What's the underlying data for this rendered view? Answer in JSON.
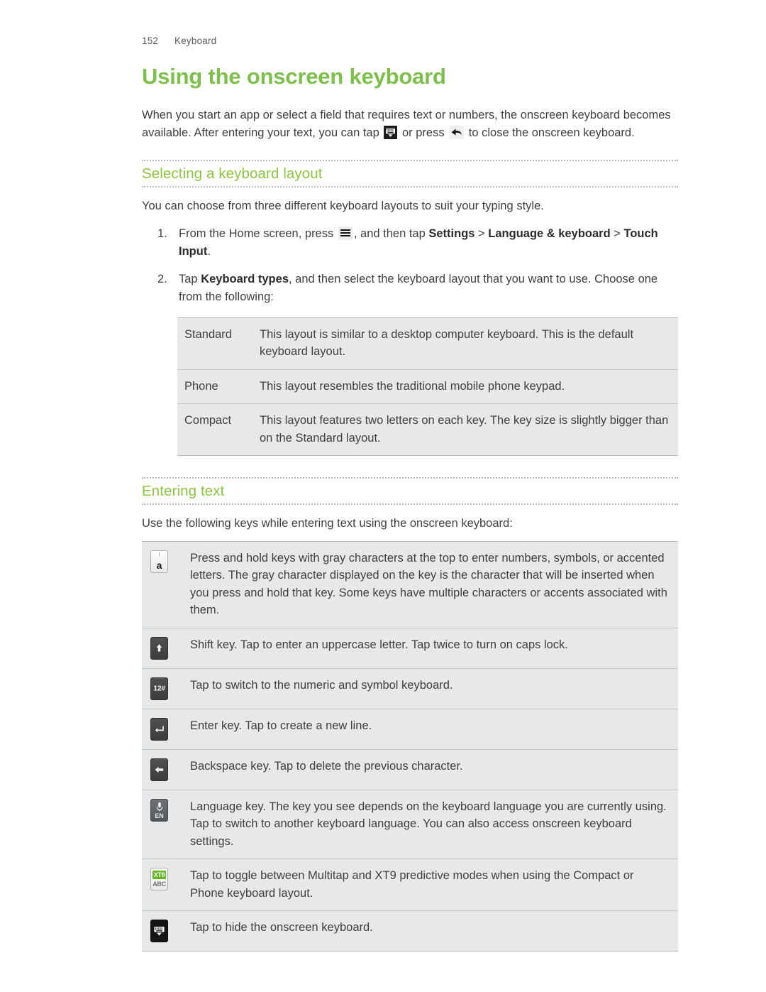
{
  "header": {
    "page_number": "152",
    "chapter": "Keyboard"
  },
  "title": "Using the onscreen keyboard",
  "intro": {
    "part1": "When you start an app or select a field that requires text or numbers, the onscreen keyboard becomes available. After entering your text, you can tap",
    "icon1": "hide-keyboard-icon",
    "part2": "or press",
    "icon2": "back-arrow-icon",
    "part3": "to close the onscreen keyboard."
  },
  "section1": {
    "heading": "Selecting a keyboard layout",
    "intro": "You can choose from three different keyboard layouts to suit your typing style.",
    "steps": [
      {
        "pre": "From the Home screen, press",
        "icon": "menu-icon",
        "mid": ", and then tap",
        "bold1": "Settings",
        "sep1": ">",
        "bold2": "Language & keyboard",
        "sep2": ">",
        "bold3": "Touch Input",
        "post": "."
      },
      {
        "pre": "Tap",
        "bold1": "Keyboard types",
        "post": ", and then select the keyboard layout that you want to use. Choose one from the following:"
      }
    ],
    "table": {
      "rows": [
        {
          "term": "Standard",
          "desc": "This layout is similar to a desktop computer keyboard. This is the default keyboard layout."
        },
        {
          "term": "Phone",
          "desc": "This layout resembles the traditional mobile phone keypad."
        },
        {
          "term": "Compact",
          "desc": "This layout features two letters on each key. The key size is slightly bigger than on the Standard layout."
        }
      ]
    }
  },
  "section2": {
    "heading": "Entering text",
    "intro": "Use the following keys while entering text using the onscreen keyboard:",
    "table": {
      "rows": [
        {
          "icon": "letter-a-key-icon",
          "key_sup": "!",
          "key_main": "a",
          "desc": "Press and hold keys with gray characters at the top to enter numbers, symbols, or accented letters. The gray character displayed on the key is the character that will be inserted when you press and hold that key. Some keys have multiple characters or accents associated with them."
        },
        {
          "icon": "shift-key-icon",
          "desc": "Shift key. Tap to enter an uppercase letter. Tap twice to turn on caps lock."
        },
        {
          "icon": "numeric-symbol-key-icon",
          "key_label": "12#",
          "desc": "Tap to switch to the numeric and symbol keyboard."
        },
        {
          "icon": "enter-key-icon",
          "desc": "Enter key. Tap to create a new line."
        },
        {
          "icon": "backspace-key-icon",
          "desc": "Backspace key. Tap to delete the previous character."
        },
        {
          "icon": "language-key-icon",
          "key_label": "EN",
          "desc": "Language key. The key you see depends on the keyboard language you are currently using. Tap to switch to another keyboard language. You can also access onscreen keyboard settings."
        },
        {
          "icon": "xt9-abc-key-icon",
          "key_top": "XT9",
          "key_bottom": "ABC",
          "desc": "Tap to toggle between Multitap and XT9 predictive modes when using the Compact or Phone keyboard layout."
        },
        {
          "icon": "hide-keyboard-key-icon",
          "desc": "Tap to hide the onscreen keyboard."
        }
      ]
    }
  },
  "colors": {
    "title_green": "#7cc04b",
    "heading_green": "#8cc63f",
    "table_bg": "#e6e8ea",
    "xt9_green": "#63b324"
  }
}
